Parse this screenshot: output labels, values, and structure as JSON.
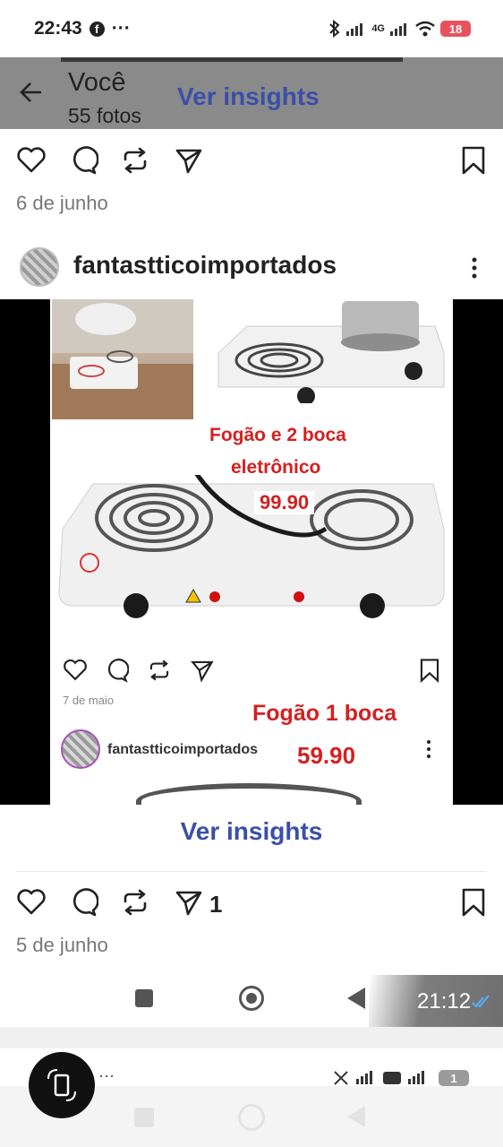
{
  "status_bar": {
    "time": "22:43",
    "facebook_icon": "facebook-icon",
    "more": "···",
    "network": "4G",
    "battery": "18"
  },
  "header": {
    "title": "Você",
    "subtitle": "55 fotos",
    "insights": "Ver insights",
    "back_icon": "arrow-left-icon"
  },
  "post1": {
    "date": "6 de junho"
  },
  "post2": {
    "username": "fantastticoimportados",
    "image_caption_1": "Fogão e 2 boca",
    "image_caption_2": "eletrônico",
    "image_caption_3": "99.90",
    "image_inner_date": "7 de maio",
    "image_inner_caption_1": "Fogão 1 boca",
    "image_inner_username": "fantastticoimportados",
    "image_inner_caption_2": "59.90",
    "insights": "Ver insights",
    "share_count": "1",
    "date": "5 de junho"
  },
  "overlay": {
    "time": "21:12"
  },
  "status_bar_2": {
    "more": "···",
    "battery": "1"
  },
  "colors": {
    "accent_link": "#3a4fa8",
    "price_red": "#d42020",
    "header_bg": "#8a8a8a",
    "battery_red": "#e8525c"
  }
}
